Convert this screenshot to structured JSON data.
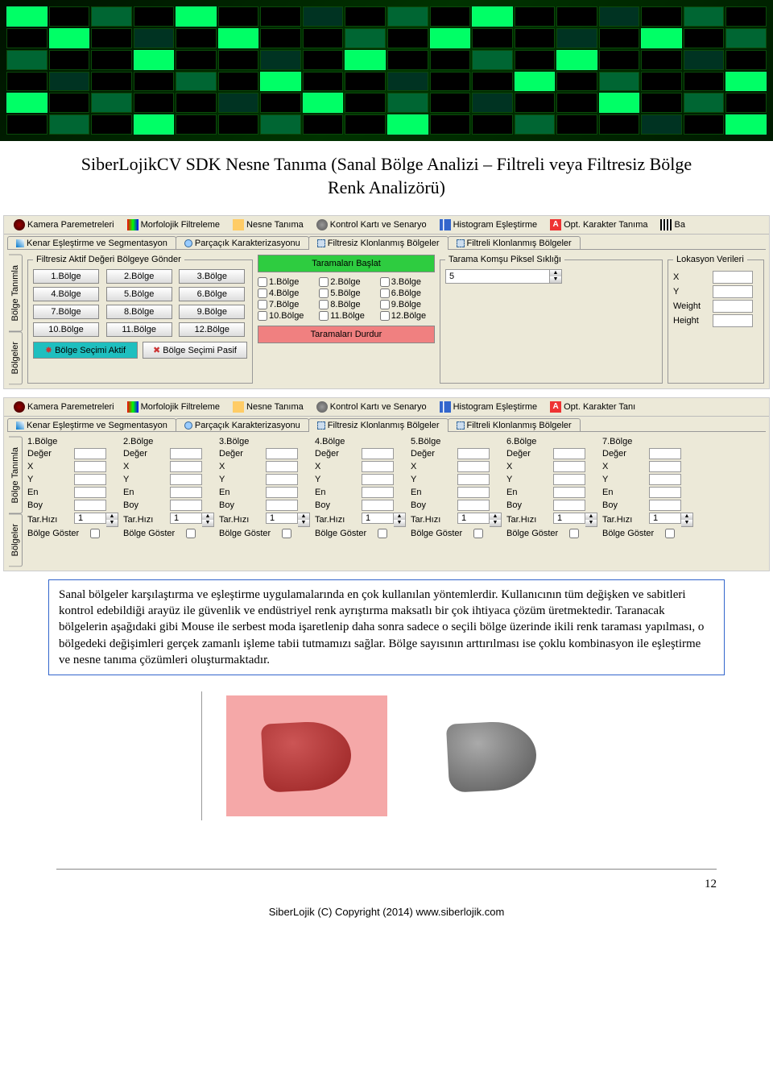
{
  "doc": {
    "title": "SiberLojikCV SDK Nesne Tanıma (Sanal Bölge Analizi – Filtreli veya Filtresiz Bölge Renk Analizörü)",
    "page_number": "12",
    "copyright": "SiberLojik (C) Copyright (2014) www.siberlojik.com"
  },
  "toolbar": {
    "kamera": "Kamera Paremetreleri",
    "morfolojik": "Morfolojik Filtreleme",
    "nesne": "Nesne Tanıma",
    "kontrol": "Kontrol Kartı ve Senaryo",
    "histogram": "Histogram Eşleştirme",
    "opt1": "Opt. Karakter Tanıma",
    "opt2": "Opt. Karakter Tanı",
    "ba": "Ba"
  },
  "tabs": {
    "kenar": "Kenar Eşleştirme ve Segmentasyon",
    "parcacik": "Parçaçık Karakterizasyonu",
    "filtresiz": "Filtresiz Klonlanmış Bölgeler",
    "filtreli": "Filtreli Klonlanmış Bölgeler"
  },
  "vtabs": {
    "bolge_tanimla": "Bölge Tanımla",
    "bolgeler": "Bölgeler"
  },
  "panel1": {
    "gonder_legend": "Filtresiz Aktif Değeri Bölgeye Gönder",
    "bolge_btns": [
      "1.Bölge",
      "2.Bölge",
      "3.Bölge",
      "4.Bölge",
      "5.Bölge",
      "6.Bölge",
      "7.Bölge",
      "8.Bölge",
      "9.Bölge",
      "10.Bölge",
      "11.Bölge",
      "12.Bölge"
    ],
    "secim_aktif": "Bölge Seçimi Aktif",
    "secim_pasif": "Bölge Seçimi Pasif",
    "baslat": "Taramaları Başlat",
    "durdur": "Taramaları Durdur",
    "chk_bolge": [
      "1.Bölge",
      "2.Bölge",
      "3.Bölge",
      "4.Bölge",
      "5.Bölge",
      "6.Bölge",
      "7.Bölge",
      "8.Bölge",
      "9.Bölge",
      "10.Bölge",
      "11.Bölge",
      "12.Bölge"
    ],
    "piksel_legend": "Tarama Komşu Piksel Sıklığı",
    "piksel_value": "5",
    "lokasyon_legend": "Lokasyon Verileri",
    "lok_labels": {
      "x": "X",
      "y": "Y",
      "w": "Weight",
      "h": "Height"
    }
  },
  "panel2": {
    "region_titles": [
      "1.Bölge",
      "2.Bölge",
      "3.Bölge",
      "4.Bölge",
      "5.Bölge",
      "6.Bölge",
      "7.Bölge"
    ],
    "labels": {
      "deger": "Değer",
      "x": "X",
      "y": "Y",
      "en": "En",
      "boy": "Boy",
      "tarhizi": "Tar.Hızı",
      "goster": "Bölge Göster"
    },
    "tarhizi_val": "1"
  },
  "description": "Sanal bölgeler karşılaştırma ve eşleştirme uygulamalarında en çok kullanılan yöntemlerdir. Kullanıcının tüm değişken ve sabitleri kontrol edebildiği arayüz ile güvenlik ve endüstriyel renk ayrıştırma maksatlı bir çok ihtiyaca çözüm üretmektedir. Taranacak bölgelerin aşağıdaki gibi Mouse ile serbest moda işaretlenip daha sonra sadece o seçili bölge üzerinde ikili renk taraması yapılması, o bölgedeki değişimleri gerçek zamanlı işleme tabii tutmamızı sağlar. Bölge sayısının arttırılması ise çoklu kombinasyon ile eşleştirme ve nesne tanıma çözümleri oluşturmaktadır."
}
